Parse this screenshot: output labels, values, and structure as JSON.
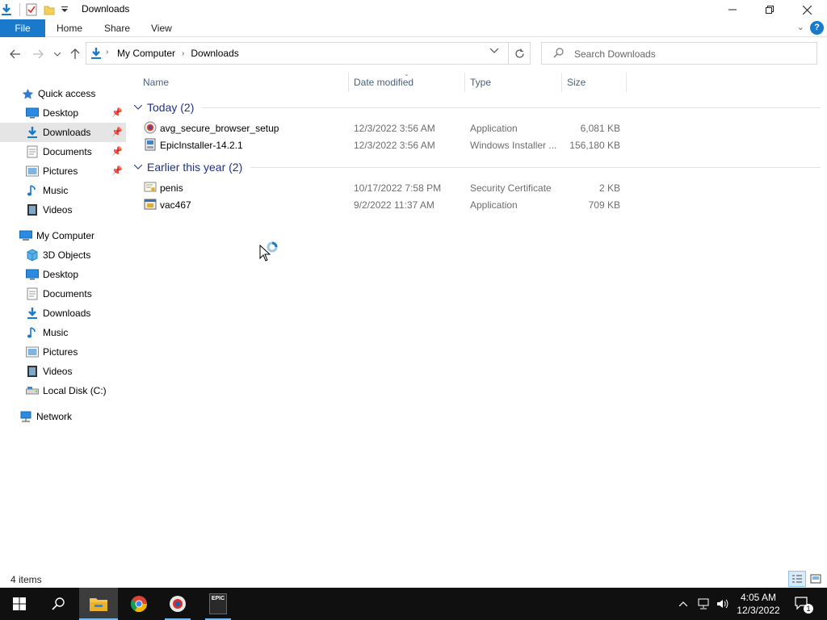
{
  "window": {
    "title": "Downloads",
    "minimize_icon": "minimize-icon",
    "maximize_icon": "restore-icon",
    "close_icon": "close-icon"
  },
  "ribbon": {
    "tabs": [
      {
        "label": "File"
      },
      {
        "label": "Share"
      },
      {
        "label": "View"
      }
    ],
    "home_label": "Home",
    "help_label": "?"
  },
  "address": {
    "crumbs": [
      "My Computer",
      "Downloads"
    ],
    "search_placeholder": "Search Downloads"
  },
  "navpane": {
    "quick_access": "Quick access",
    "quick_items": [
      {
        "label": "Desktop",
        "icon": "desktop-icon",
        "pinned": true
      },
      {
        "label": "Downloads",
        "icon": "downloads-icon",
        "pinned": true,
        "selected": true
      },
      {
        "label": "Documents",
        "icon": "documents-icon",
        "pinned": true
      },
      {
        "label": "Pictures",
        "icon": "pictures-icon",
        "pinned": true
      },
      {
        "label": "Music",
        "icon": "music-icon"
      },
      {
        "label": "Videos",
        "icon": "videos-icon"
      }
    ],
    "my_computer": "My Computer",
    "computer_items": [
      {
        "label": "3D Objects",
        "icon": "3d-objects-icon"
      },
      {
        "label": "Desktop",
        "icon": "desktop-icon"
      },
      {
        "label": "Documents",
        "icon": "documents-icon"
      },
      {
        "label": "Downloads",
        "icon": "downloads-icon"
      },
      {
        "label": "Music",
        "icon": "music-icon"
      },
      {
        "label": "Pictures",
        "icon": "pictures-icon"
      },
      {
        "label": "Videos",
        "icon": "videos-icon"
      },
      {
        "label": "Local Disk (C:)",
        "icon": "local-disk-icon"
      }
    ],
    "network": "Network"
  },
  "columns": {
    "name": "Name",
    "date": "Date modified",
    "type": "Type",
    "size": "Size"
  },
  "groups": [
    {
      "label": "Today (2)",
      "files": [
        {
          "name": "avg_secure_browser_setup",
          "date": "12/3/2022 3:56 AM",
          "type": "Application",
          "size": "6,081 KB",
          "icon": "avg-installer-icon"
        },
        {
          "name": "EpicInstaller-14.2.1",
          "date": "12/3/2022 3:56 AM",
          "type": "Windows Installer ...",
          "size": "156,180 KB",
          "icon": "msi-installer-icon"
        }
      ]
    },
    {
      "label": "Earlier this year (2)",
      "files": [
        {
          "name": "penis",
          "date": "10/17/2022 7:58 PM",
          "type": "Security Certificate",
          "size": "2 KB",
          "icon": "certificate-icon"
        },
        {
          "name": "vac467",
          "date": "9/2/2022 11:37 AM",
          "type": "Application",
          "size": "709 KB",
          "icon": "application-icon"
        }
      ]
    }
  ],
  "status": {
    "item_count": "4 items"
  },
  "taskbar": {
    "items": [
      "start-icon",
      "search-icon",
      "file-explorer-icon",
      "chrome-icon",
      "avg-browser-icon",
      "epic-games-icon"
    ],
    "epic_label": "EPIC",
    "time": "4:05 AM",
    "date": "12/3/2022",
    "notification_count": "1"
  },
  "colors": {
    "accent": "#1979ca",
    "group_header": "#1e3287",
    "selected_bg": "#e5e5e5",
    "taskbar": "#101010"
  }
}
